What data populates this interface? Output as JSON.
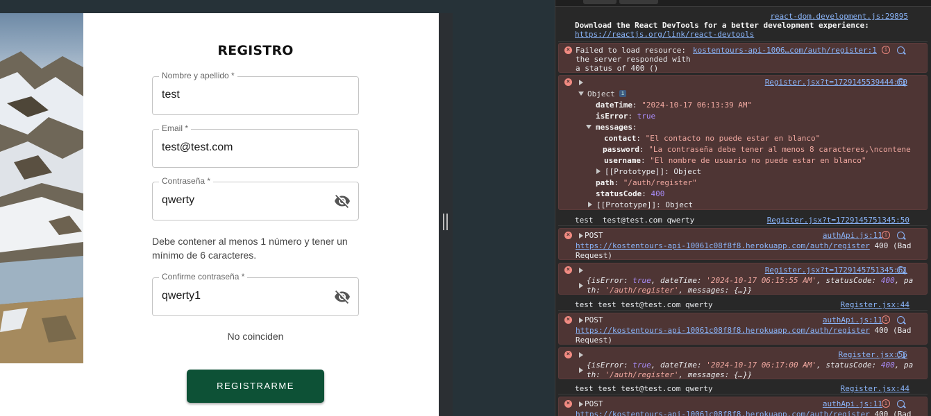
{
  "form": {
    "title": "REGISTRO",
    "name_label": "Nombre y apellido *",
    "name_value": "test",
    "email_label": "Email *",
    "email_value": "test@test.com",
    "password_label": "Contraseña *",
    "password_value": "qwerty",
    "password_hint": "Debe contener al menos 1 número y tener un mínimo de 6 caracteres.",
    "confirm_label": "Confirme contraseña *",
    "confirm_value": "qwerty1",
    "mismatch_text": "No coinciden",
    "submit_label": "REGISTRARME"
  },
  "console": {
    "m1": {
      "source": "react-dom.development.js:29895",
      "text1": "Download the React DevTools for a better development experience:",
      "link": "https://reactjs.org/link/react-devtools"
    },
    "m2": {
      "prefix": "Failed to load resource: ",
      "link": "kostentours-api-1006…com/auth/register:1",
      "text2": "the server responded with",
      "text3": "a status of 400 ()"
    },
    "m3": {
      "source": "Register.jsx?t=1729145539444:60",
      "obj": "Object",
      "dateTime_key": "dateTime",
      "dateTime_val": "\"2024-10-17 06:13:39 AM\"",
      "isError_key": "isError",
      "isError_val": "true",
      "messages_key": "messages",
      "contact_key": "contact",
      "contact_val": "\"El contacto no puede estar en blanco\"",
      "password_key": "password",
      "password_val": "\"La contraseña debe tener al menos 8 caracteres,\\ncontene",
      "username_key": "username",
      "username_val": "\"El nombre de usuario no puede estar en blanco\"",
      "proto1": "[[Prototype]]",
      "proto_val": "Object",
      "path_key": "path",
      "path_val": "\"/auth/register\"",
      "status_key": "statusCode",
      "status_val": "400",
      "proto2": "[[Prototype]]"
    },
    "m4": {
      "text": "test  test@test.com qwerty",
      "source": "Register.jsx?t=1729145751345:50"
    },
    "m5": {
      "method": "POST",
      "source": "authApi.js:11",
      "url": "https://kostentours-api-10061c08f8f8.herokuapp.com/auth/register",
      "status": " 400 (Bad",
      "status2": "Request)"
    },
    "m6": {
      "source": "Register.jsx?t=1729145751345:61",
      "line1a": "{isError: ",
      "line1b": "true",
      "line1c": ", dateTime: ",
      "line1d": "'2024-10-17 06:15:55 AM'",
      "line1e": ", statusCode: ",
      "line1f": "400",
      "line1g": ", pa",
      "line2a": "th: ",
      "line2b": "'/auth/register'",
      "line2c": ", messages: {…}}"
    },
    "m7": {
      "text": "test test test@test.com qwerty",
      "source": "Register.jsx:44"
    },
    "m8": {
      "method": "POST",
      "source": "authApi.js:11",
      "url": "https://kostentours-api-10061c08f8f8.herokuapp.com/auth/register",
      "status": " 400 (Bad",
      "status2": "Request)"
    },
    "m9": {
      "source": "Register.jsx:56",
      "line1a": "{isError: ",
      "line1b": "true",
      "line1c": ", dateTime: ",
      "line1d": "'2024-10-17 06:17:00 AM'",
      "line1e": ", statusCode: ",
      "line1f": "400",
      "line1g": ", pa",
      "line2a": "th: ",
      "line2b": "'/auth/register'",
      "line2c": ", messages: {…}}"
    },
    "m10": {
      "text": "test test test@test.com qwerty",
      "source": "Register.jsx:44"
    },
    "m11": {
      "method": "POST",
      "source": "authApi.js:11",
      "url": "https://kostentours-api-10061c08f8f8.herokuapp.com/auth/register",
      "status": " 400 (Bad"
    }
  },
  "colors": {
    "submit_bg": "#0d5136",
    "error_row_bg": "#4e3534",
    "link": "#8ab4f8"
  }
}
